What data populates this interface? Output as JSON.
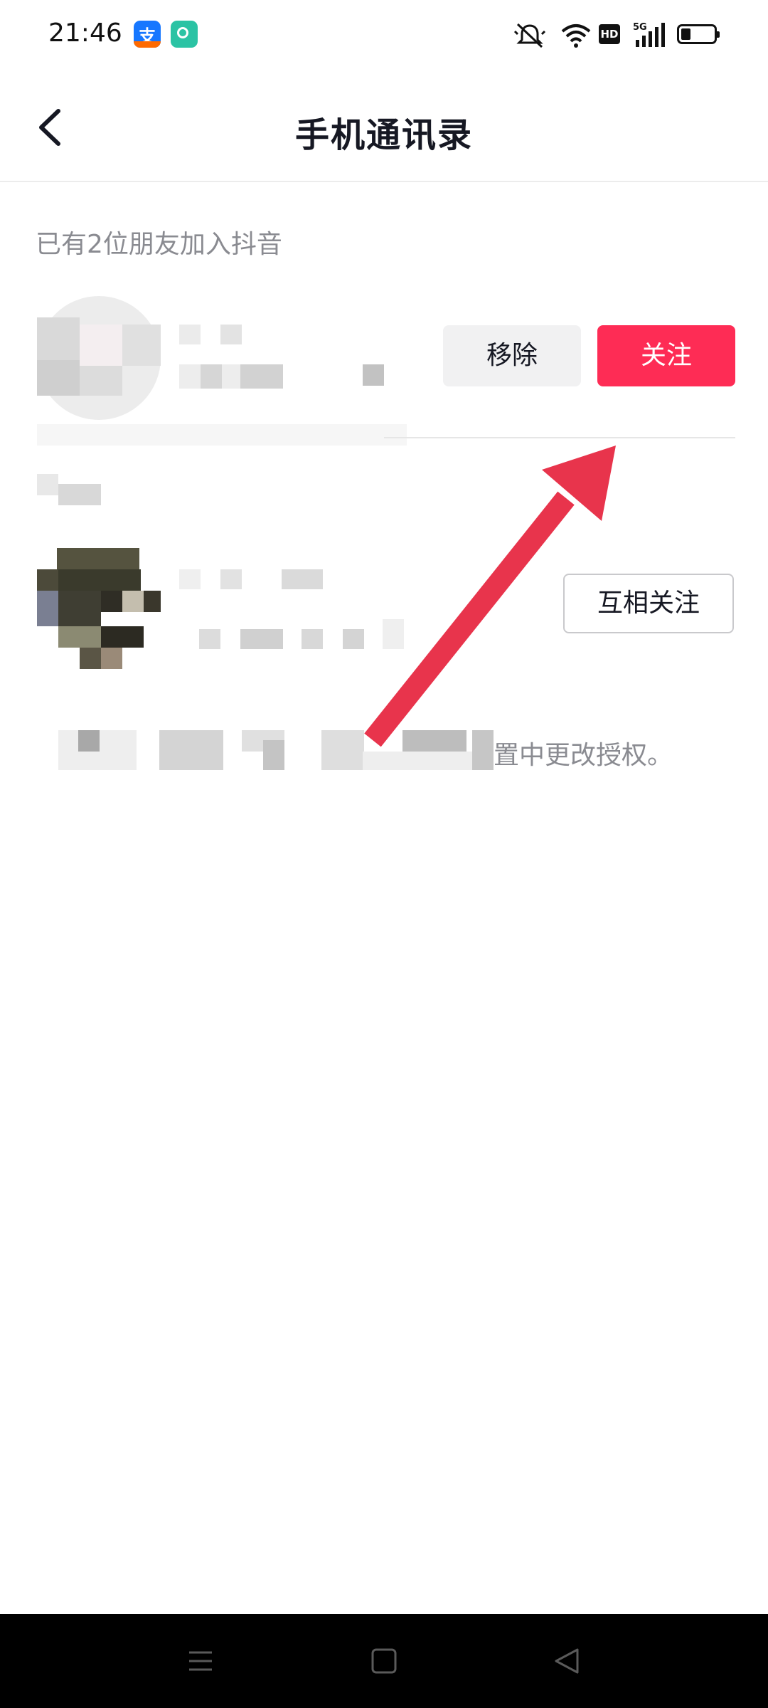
{
  "status_bar": {
    "time": "21:46",
    "app_icons": [
      "alipay-icon",
      "green-app-icon"
    ],
    "right_icons": [
      "mute-icon",
      "wifi-icon",
      "hd-icon",
      "signal-5g-icon",
      "battery-icon"
    ],
    "hd_label": "HD",
    "network_label": "5G"
  },
  "header": {
    "title": "手机通讯录",
    "back_icon": "chevron-left-icon"
  },
  "content": {
    "section_label": "已有2位朋友加入抖音",
    "contacts": [
      {
        "actions": {
          "remove_label": "移除",
          "follow_label": "关注"
        }
      },
      {
        "actions": {
          "mutual_label": "互相关注"
        }
      }
    ],
    "footer_note": "置中更改授权。"
  },
  "annotation": {
    "arrow_color": "#e8344c"
  },
  "colors": {
    "accent": "#fe2c55",
    "text_primary": "#161823",
    "text_secondary": "#8a8b91"
  },
  "nav_bar": {
    "buttons": [
      "menu-icon",
      "home-icon",
      "back-triangle-icon"
    ]
  }
}
